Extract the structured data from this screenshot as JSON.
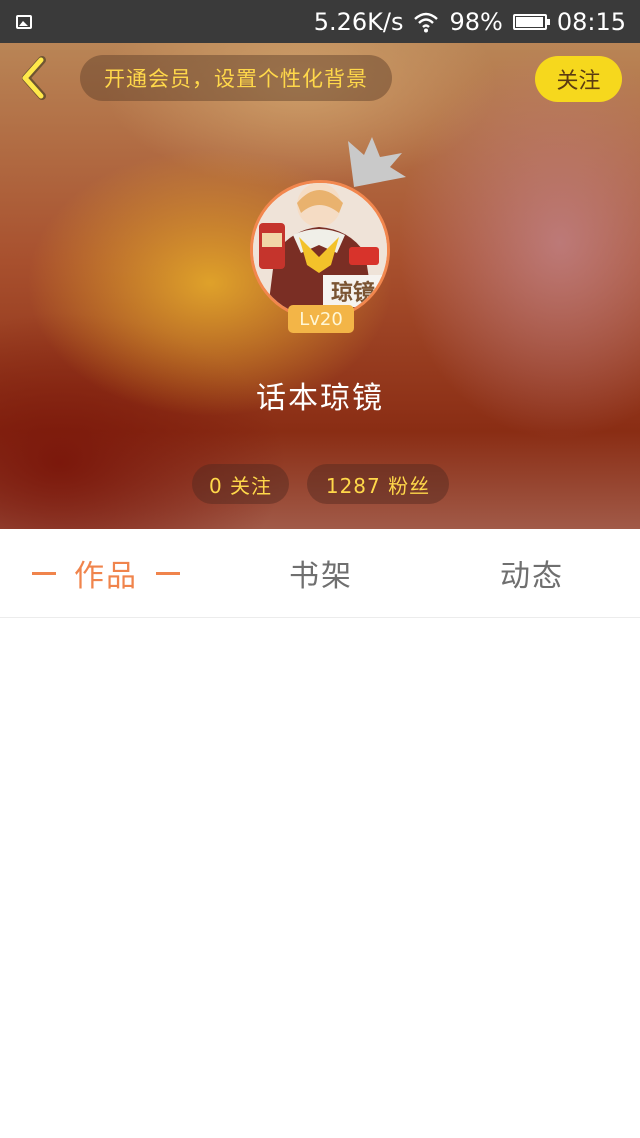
{
  "status_bar": {
    "speed": "5.26K/s",
    "battery": "98%",
    "battery_level": 0.98,
    "time": "08:15"
  },
  "header": {
    "vip_text": "开通会员，设置个性化背景",
    "follow_label": "关注",
    "level": "Lv20",
    "avatar_text": "琼镜",
    "username": "话本琼镜",
    "following": "0 关注",
    "fans": "1287 粉丝"
  },
  "tabs": [
    {
      "label": "作品",
      "active": true
    },
    {
      "label": "书架",
      "active": false
    },
    {
      "label": "动态",
      "active": false
    }
  ],
  "colors": {
    "accent": "#f0844c",
    "vip_text": "#ffd84a",
    "follow_button": "#f6d81d",
    "status_bar": "#3a3a3a"
  }
}
